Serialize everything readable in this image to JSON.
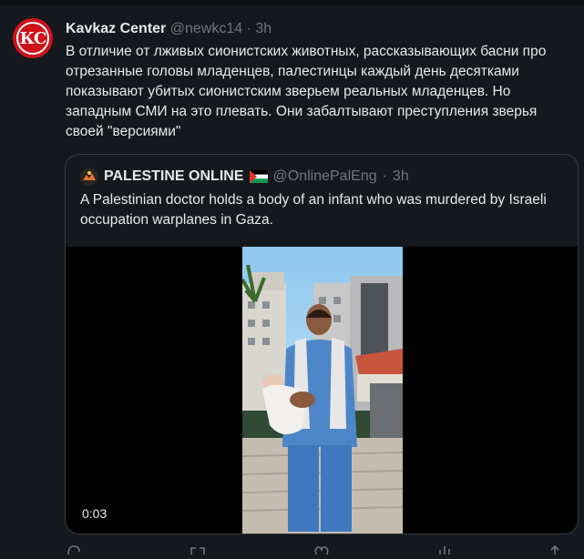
{
  "tweet": {
    "author_name": "Kavkaz Center",
    "handle": "@newkc14",
    "separator": "·",
    "time": "3h",
    "avatar_text": "КС",
    "text": "В отличие от лживых сионистских животных, рассказывающих басни про отрезанные головы младенцев, палестинцы каждый день десятками показывают убитых сионистским зверьем реальных младенцев. Но западным СМИ на это плевать. Они забалтывают преступления зверья своей \"версиями\""
  },
  "quote": {
    "author_name": "PALESTINE ONLINE",
    "handle": "@OnlinePalEng",
    "separator": "·",
    "time": "3h",
    "text": "A Palestinian doctor holds a body of an infant who was murdered by Israeli occupation warplanes in Gaza.",
    "video_time": "0:03"
  },
  "icons": [
    "reply-icon",
    "retweet-icon",
    "like-icon",
    "views-icon",
    "share-icon"
  ],
  "colors": {
    "background": "#15181c",
    "text": "#e7e9ea",
    "muted": "#71767b",
    "border": "#383c40",
    "avatar_red": "#d0121b"
  }
}
